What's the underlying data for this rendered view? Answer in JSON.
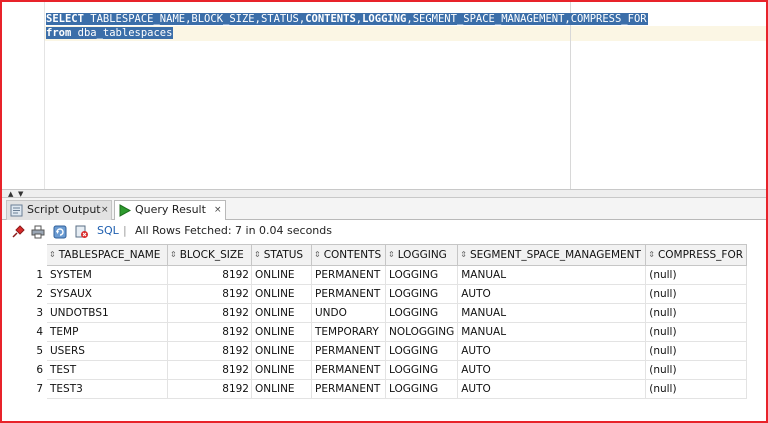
{
  "editor": {
    "line1": [
      {
        "text": "SELECT",
        "kw": true
      },
      {
        "text": " TABLESPACE_NAME,BLOCK_SIZE,STATUS,",
        "kw": false
      },
      {
        "text": "CONTENTS",
        "kw": true
      },
      {
        "text": ",",
        "kw": false
      },
      {
        "text": "LOGGING",
        "kw": true
      },
      {
        "text": ",SEGMENT_SPACE_MANAGEMENT,COMPRESS_FOR",
        "kw": false
      }
    ],
    "line2": [
      {
        "text": "from",
        "kw": true
      },
      {
        "text": " dba_tablespaces",
        "kw": false
      }
    ]
  },
  "tabs": [
    {
      "label": "Script Output",
      "close": "×",
      "icon": "script-output-icon",
      "active": false
    },
    {
      "label": "Query Result",
      "close": "×",
      "icon": "play-icon",
      "active": true
    }
  ],
  "toolbar": {
    "icons": [
      "pin-icon",
      "print-icon",
      "refresh-icon",
      "cancel-query-icon"
    ],
    "sql_label": "SQL",
    "separator": "|",
    "status": "All Rows Fetched: 7 in 0.04 seconds"
  },
  "grid": {
    "columns": [
      "TABLESPACE_NAME",
      "BLOCK_SIZE",
      "STATUS",
      "CONTENTS",
      "LOGGING",
      "SEGMENT_SPACE_MANAGEMENT",
      "COMPRESS_FOR"
    ],
    "rows": [
      [
        "1",
        "SYSTEM",
        "8192",
        "ONLINE",
        "PERMANENT",
        "LOGGING",
        "MANUAL",
        "(null)"
      ],
      [
        "2",
        "SYSAUX",
        "8192",
        "ONLINE",
        "PERMANENT",
        "LOGGING",
        "AUTO",
        "(null)"
      ],
      [
        "3",
        "UNDOTBS1",
        "8192",
        "ONLINE",
        "UNDO",
        "LOGGING",
        "MANUAL",
        "(null)"
      ],
      [
        "4",
        "TEMP",
        "8192",
        "ONLINE",
        "TEMPORARY",
        "NOLOGGING",
        "MANUAL",
        "(null)"
      ],
      [
        "5",
        "USERS",
        "8192",
        "ONLINE",
        "PERMANENT",
        "LOGGING",
        "AUTO",
        "(null)"
      ],
      [
        "6",
        "TEST",
        "8192",
        "ONLINE",
        "PERMANENT",
        "LOGGING",
        "AUTO",
        "(null)"
      ],
      [
        "7",
        "TEST3",
        "8192",
        "ONLINE",
        "PERMANENT",
        "LOGGING",
        "AUTO",
        "(null)"
      ]
    ]
  },
  "colors": {
    "frame_border": "#e8232a",
    "selection": "#3b6ea9",
    "play_green": "#2e9b2e",
    "link_blue": "#2060b0"
  }
}
